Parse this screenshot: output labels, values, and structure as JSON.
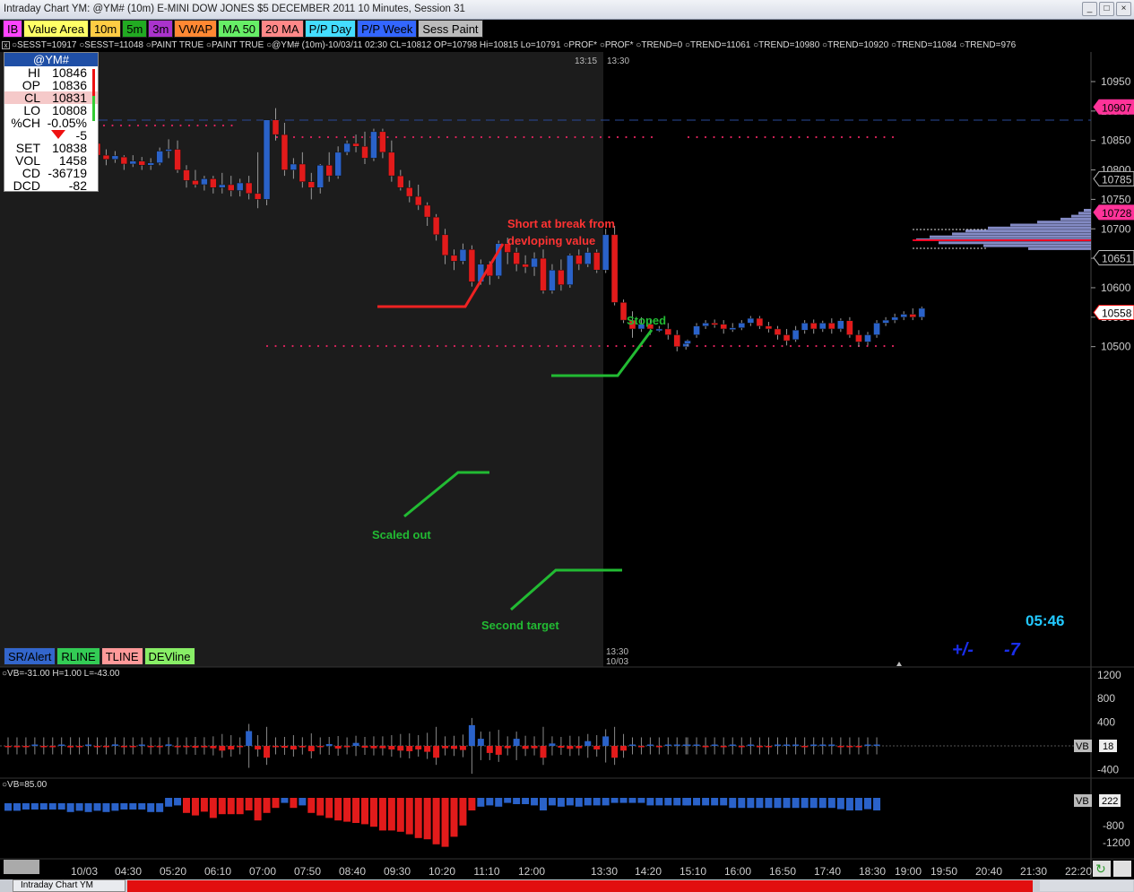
{
  "window": {
    "title": "Intraday Chart YM: @YM# (10m) E-MINI DOW JONES $5 DECEMBER 2011 10 Minutes, Session 31",
    "min_label": "_",
    "max_label": "□",
    "close_label": "×"
  },
  "toolbar": [
    {
      "label": "IB",
      "color": "#ff44ff"
    },
    {
      "label": "Value Area",
      "color": "#ffff66"
    },
    {
      "label": "10m",
      "color": "#ffcc44"
    },
    {
      "label": "5m",
      "color": "#22aa22"
    },
    {
      "label": "3m",
      "color": "#aa33cc"
    },
    {
      "label": "VWAP",
      "color": "#ff8833"
    },
    {
      "label": "MA 50",
      "color": "#66ee66"
    },
    {
      "label": "20 MA",
      "color": "#ff8888"
    },
    {
      "label": "P/P Day",
      "color": "#44ddff"
    },
    {
      "label": "P/P Week",
      "color": "#3366ff"
    },
    {
      "label": "Sess Paint",
      "color": "#bbbbbb"
    }
  ],
  "infoline": "○SESST=10917 ○SESST=11048 ○PAINT TRUE ○PAINT TRUE ○@YM# (10m)-10/03/11 02:30 CL=10812 OP=10798 Hi=10815 Lo=10791 ○PROF* ○PROF* ○TREND=0 ○TREND=11061 ○TREND=10980 ○TREND=10920 ○TREND=11084 ○TREND=976",
  "quote": {
    "symbol": "@YM#",
    "rows": [
      {
        "label": "HI",
        "value": "10846"
      },
      {
        "label": "OP",
        "value": "10836"
      },
      {
        "label": "CL",
        "value": "10831"
      },
      {
        "label": "LO",
        "value": "10808"
      },
      {
        "label": "%CH",
        "value": "-0.05%"
      },
      {
        "label": "",
        "value": "-5"
      },
      {
        "label": "SET",
        "value": "10838"
      },
      {
        "label": "VOL",
        "value": "1458"
      },
      {
        "label": "CD",
        "value": "-36719"
      },
      {
        "label": "DCD",
        "value": "-82"
      }
    ]
  },
  "bottom_buttons": [
    {
      "label": "SR/Alert",
      "color": "#3366cc"
    },
    {
      "label": "RLINE",
      "color": "#33cc55"
    },
    {
      "label": "TLINE",
      "color": "#ff9999"
    },
    {
      "label": "DEVline",
      "color": "#88ee66"
    }
  ],
  "price_axis": {
    "ticks": [
      "10950",
      "10900",
      "10850",
      "10800",
      "10750",
      "10700",
      "10650",
      "10600",
      "10550",
      "10500"
    ],
    "markers": [
      {
        "label": "10907",
        "color": "#ff3399"
      },
      {
        "label": "10785",
        "color": "#bbbbbb"
      },
      {
        "label": "10728",
        "color": "#ff3399"
      },
      {
        "label": "10651",
        "color": "#bbbbbb"
      },
      {
        "label": "10558",
        "color": "#ffffff"
      }
    ]
  },
  "chart_time_labels": {
    "top": [
      "13:15",
      "13:30"
    ],
    "bottom": [
      "13:30",
      "10/03"
    ]
  },
  "timer": "05:46",
  "plusminus": {
    "label": "+/-",
    "value": "-7"
  },
  "annotations": {
    "short": [
      "Short at break from",
      "devloping value"
    ],
    "stoped": "Stoped",
    "scaled": "Scaled out",
    "second": "Second target"
  },
  "sub1": {
    "label": "○VB=-31.00 H=1.00 L=-43.00",
    "ticks": [
      "1200",
      "800",
      "400",
      "-400"
    ],
    "marker": "18",
    "marker_tag": "VB"
  },
  "sub2": {
    "label": "○VB=85.00",
    "ticks": [
      "-800",
      "-1200"
    ],
    "marker": "222",
    "marker_tag": "VB"
  },
  "time_axis": [
    "10/03",
    "04:30",
    "05:20",
    "06:10",
    "07:00",
    "07:50",
    "08:40",
    "09:30",
    "10:20",
    "11:10",
    "12:00",
    "13:30",
    "14:20",
    "15:10",
    "16:00",
    "16:50",
    "17:40",
    "18:30",
    "19:00",
    "19:50",
    "20:40",
    "21:30",
    "22:20"
  ],
  "taskbar": {
    "tab": "Intraday Chart YM"
  },
  "colors": {
    "up": "#2a62c9",
    "down": "#e21b1b",
    "green": "#22bb33",
    "red": "#ee2222"
  },
  "chart_data": {
    "type": "candlestick",
    "yrange": [
      10460,
      11000
    ],
    "candles": [
      [
        10790,
        10805,
        10780,
        10775
      ],
      [
        10805,
        10822,
        10810,
        10795
      ],
      [
        10812,
        10825,
        10818,
        10800
      ],
      [
        10800,
        10818,
        10805,
        10788
      ],
      [
        10805,
        10812,
        10790,
        10782
      ],
      [
        10790,
        10808,
        10786,
        10778
      ],
      [
        10790,
        10830,
        10825,
        10785
      ],
      [
        10825,
        10838,
        10815,
        10805
      ],
      [
        10815,
        10840,
        10830,
        10808
      ],
      [
        10838,
        10850,
        10845,
        10828
      ],
      [
        10845,
        10855,
        10825,
        10818
      ],
      [
        10825,
        10835,
        10818,
        10808
      ],
      [
        10818,
        10832,
        10824,
        10812
      ],
      [
        10822,
        10825,
        10810,
        10800
      ],
      [
        10810,
        10825,
        10815,
        10805
      ],
      [
        10815,
        10822,
        10808,
        10800
      ],
      [
        10808,
        10820,
        10812,
        10800
      ],
      [
        10812,
        10838,
        10832,
        10808
      ],
      [
        10832,
        10852,
        10835,
        10820
      ],
      [
        10835,
        10850,
        10800,
        10795
      ],
      [
        10800,
        10808,
        10782,
        10770
      ],
      [
        10782,
        10800,
        10775,
        10770
      ],
      [
        10775,
        10790,
        10785,
        10765
      ],
      [
        10785,
        10790,
        10770,
        10760
      ],
      [
        10770,
        10795,
        10775,
        10760
      ],
      [
        10775,
        10790,
        10765,
        10755
      ],
      [
        10765,
        10785,
        10778,
        10755
      ],
      [
        10778,
        10790,
        10760,
        10750
      ],
      [
        10760,
        10830,
        10750,
        10735
      ],
      [
        10750,
        10880,
        10885,
        10740
      ],
      [
        10885,
        10905,
        10860,
        10850
      ],
      [
        10860,
        10880,
        10800,
        10790
      ],
      [
        10800,
        10820,
        10810,
        10785
      ],
      [
        10810,
        10830,
        10780,
        10770
      ],
      [
        10780,
        10795,
        10770,
        10750
      ],
      [
        10770,
        10810,
        10808,
        10760
      ],
      [
        10808,
        10830,
        10790,
        10780
      ],
      [
        10790,
        10840,
        10830,
        10785
      ],
      [
        10830,
        10850,
        10845,
        10825
      ],
      [
        10845,
        10860,
        10840,
        10830
      ],
      [
        10840,
        10865,
        10820,
        10810
      ],
      [
        10820,
        10870,
        10865,
        10815
      ],
      [
        10865,
        10870,
        10830,
        10820
      ],
      [
        10830,
        10850,
        10790,
        10780
      ],
      [
        10790,
        10800,
        10770,
        10765
      ],
      [
        10770,
        10782,
        10755,
        10745
      ],
      [
        10755,
        10775,
        10740,
        10732
      ],
      [
        10740,
        10745,
        10720,
        10705
      ],
      [
        10720,
        10725,
        10690,
        10680
      ],
      [
        10690,
        10700,
        10655,
        10640
      ],
      [
        10655,
        10665,
        10645,
        10630
      ],
      [
        10645,
        10675,
        10665,
        10640
      ],
      [
        10665,
        10672,
        10610,
        10602
      ],
      [
        10610,
        10648,
        10640,
        10605
      ],
      [
        10640,
        10645,
        10620,
        10605
      ],
      [
        10620,
        10680,
        10675,
        10615
      ],
      [
        10675,
        10685,
        10660,
        10640
      ],
      [
        10660,
        10668,
        10640,
        10628
      ],
      [
        10640,
        10655,
        10635,
        10625
      ],
      [
        10635,
        10660,
        10650,
        10620
      ],
      [
        10650,
        10665,
        10595,
        10590
      ],
      [
        10595,
        10640,
        10630,
        10590
      ],
      [
        10630,
        10648,
        10605,
        10595
      ],
      [
        10605,
        10658,
        10655,
        10600
      ],
      [
        10655,
        10665,
        10640,
        10630
      ],
      [
        10640,
        10668,
        10660,
        10635
      ],
      [
        10660,
        10665,
        10630,
        10625
      ],
      [
        10630,
        10700,
        10690,
        10625
      ],
      [
        10690,
        10705,
        10575,
        10570
      ],
      [
        10575,
        10580,
        10545,
        10540
      ],
      [
        10545,
        10560,
        10530,
        10515
      ],
      [
        10530,
        10550,
        10538,
        10525
      ],
      [
        10538,
        10545,
        10530,
        10520
      ],
      [
        10530,
        10535,
        10530,
        10525
      ],
      [
        10530,
        10540,
        10520,
        10512
      ],
      [
        10520,
        10528,
        10500,
        10492
      ],
      [
        10500,
        10510,
        10505,
        10495
      ],
      [
        10505,
        10512,
        10510,
        10500
      ],
      [
        10520,
        10540,
        10535,
        10515
      ],
      [
        10535,
        10545,
        10540,
        10530
      ],
      [
        10540,
        10546,
        10538,
        10532
      ],
      [
        10538,
        10545,
        10530,
        10522
      ],
      [
        10530,
        10540,
        10532,
        10525
      ],
      [
        10532,
        10545,
        10540,
        10528
      ],
      [
        10540,
        10552,
        10548,
        10535
      ],
      [
        10548,
        10552,
        10535,
        10530
      ],
      [
        10535,
        10542,
        10530,
        10524
      ],
      [
        10530,
        10535,
        10520,
        10512
      ],
      [
        10520,
        10530,
        10510,
        10502
      ],
      [
        10512,
        10535,
        10528,
        10508
      ],
      [
        10528,
        10545,
        10540,
        10522
      ],
      [
        10540,
        10546,
        10530,
        10522
      ],
      [
        10530,
        10544,
        10540,
        10525
      ],
      [
        10540,
        10548,
        10530,
        10522
      ],
      [
        10530,
        10548,
        10544,
        10525
      ],
      [
        10544,
        10550,
        10520,
        10515
      ],
      [
        10520,
        10528,
        10508,
        10500
      ],
      [
        10508,
        10525,
        10520,
        10502
      ],
      [
        10520,
        10545,
        10540,
        10515
      ],
      [
        10540,
        10550,
        10545,
        10535
      ],
      [
        10545,
        10556,
        10550,
        10540
      ],
      [
        10550,
        10560,
        10555,
        10545
      ],
      [
        10555,
        10565,
        10550,
        10545
      ],
      [
        10550,
        10568,
        10565,
        10545
      ]
    ],
    "vb": [
      -20,
      -10,
      -15,
      5,
      -10,
      -20,
      10,
      -25,
      -15,
      15,
      -5,
      -20,
      25,
      -10,
      -10,
      15,
      -15,
      -10,
      25,
      -15,
      -20,
      -30,
      -25,
      -40,
      -80,
      -60,
      -20,
      250,
      -60,
      -200,
      -20,
      -30,
      -60,
      -25,
      -90,
      -10,
      30,
      -45,
      -10,
      50,
      -30,
      -40,
      -40,
      -60,
      -80,
      -90,
      -60,
      -100,
      -200,
      -40,
      -50,
      -70,
      350,
      120,
      -120,
      -150,
      -40,
      120,
      -50,
      -40,
      -200,
      40,
      -30,
      -50,
      -40,
      80,
      -60,
      160,
      -200,
      -80,
      20,
      -10,
      10,
      -10,
      0,
      5,
      0,
      10,
      5,
      -10,
      5,
      -5,
      10,
      -5,
      5,
      -5,
      -10,
      5,
      10,
      5,
      -5,
      10,
      5,
      5,
      -10,
      -5,
      -10,
      10,
      5
    ],
    "cd": [
      60,
      60,
      50,
      50,
      50,
      50,
      50,
      70,
      60,
      70,
      60,
      70,
      60,
      50,
      50,
      50,
      70,
      70,
      70,
      60,
      120,
      140,
      110,
      160,
      130,
      130,
      130,
      100,
      180,
      120,
      80,
      40,
      80,
      60,
      120,
      140,
      160,
      180,
      190,
      200,
      210,
      230,
      260,
      260,
      270,
      290,
      320,
      330,
      370,
      390,
      310,
      220,
      100,
      70,
      60,
      70,
      40,
      50,
      50,
      60,
      100,
      60,
      70,
      60,
      70,
      60,
      60,
      60,
      40,
      40,
      40,
      40,
      60,
      60,
      60,
      60,
      60,
      60,
      60,
      60,
      60,
      60,
      80,
      80,
      80,
      80,
      80,
      80,
      80,
      80,
      80,
      80,
      80,
      80,
      90,
      100,
      100,
      90,
      100
    ]
  }
}
